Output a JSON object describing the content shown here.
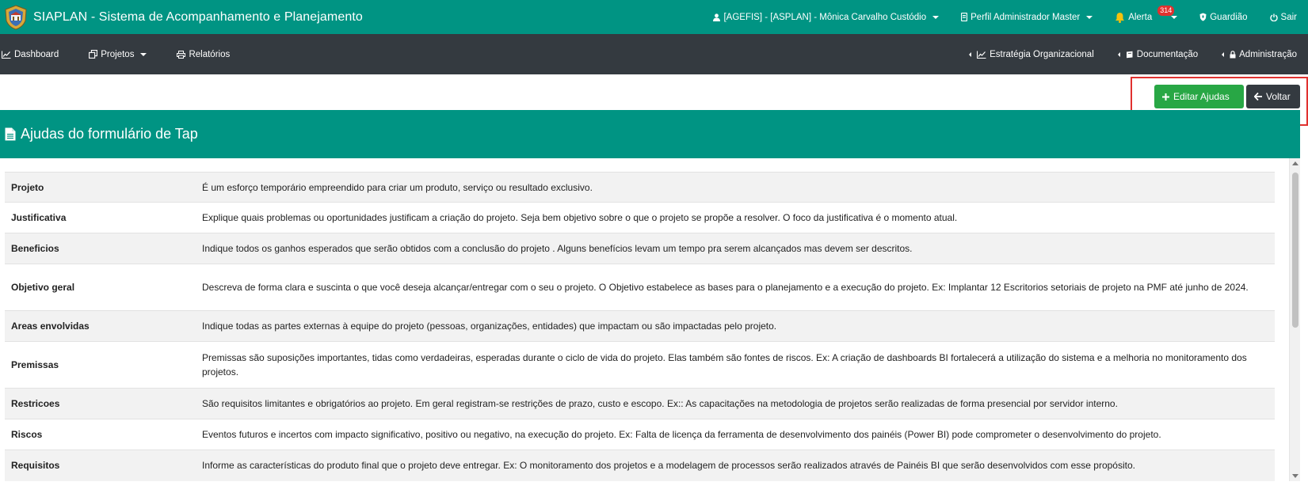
{
  "app": {
    "title": "SIAPLAN - Sistema de Acompanhamento e Planejamento",
    "brand_color": "#009483"
  },
  "topbar": {
    "user_label": "[AGEFIS] - [ASPLAN] - Mônica Carvalho Custódio",
    "profile_label": "Perfil Administrador Master",
    "alert_label": "Alerta",
    "alert_count": "314",
    "guardian_label": "Guardião",
    "exit_label": "Sair"
  },
  "nav": {
    "dashboard": "Dashboard",
    "projetos": "Projetos",
    "relatorios": "Relatórios",
    "estrategia": "Estratégia Organizacional",
    "documentacao": "Documentação",
    "administracao": "Administração"
  },
  "actions": {
    "edit_label": "Editar Ajudas",
    "back_label": "Voltar"
  },
  "panel": {
    "title": "Ajudas do formulário de Tap"
  },
  "rows": [
    {
      "label": "Projeto",
      "desc": "É um esforço temporário empreendido para criar um produto, serviço ou resultado exclusivo."
    },
    {
      "label": "Justificativa",
      "desc": "Explique quais problemas ou oportunidades justificam a criação do projeto. Seja bem objetivo sobre o que o projeto se propõe a resolver. O foco da justificativa é o momento atual."
    },
    {
      "label": "Beneficios",
      "desc": "Indique todos os ganhos esperados que serão obtidos com a conclusão do projeto . Alguns benefícios levam um tempo pra serem alcançados mas devem ser descritos."
    },
    {
      "label": "Objetivo geral",
      "desc": "Descreva de forma clara e suscinta o que você deseja alcançar/entregar com o seu o projeto. O Objetivo estabelece as bases para o planejamento e a execução do projeto. Ex: Implantar 12 Escritorios setoriais de projeto na PMF até junho de 2024."
    },
    {
      "label": "Areas envolvidas",
      "desc": "Indique todas as partes externas à equipe do projeto (pessoas, organizações, entidades) que impactam ou são impactadas pelo projeto."
    },
    {
      "label": "Premissas",
      "desc": "Premissas são suposições importantes, tidas como verdadeiras, esperadas durante o ciclo de vida do projeto. Elas também são fontes de riscos. Ex: A criação de dashboards BI fortalecerá a utilização do sistema e a melhoria no monitoramento dos projetos."
    },
    {
      "label": "Restricoes",
      "desc": "São requisitos limitantes e obrigatórios ao projeto. Em geral registram-se restrições de prazo, custo e escopo. Ex:: As capacitações na metodologia de projetos serão realizadas de forma presencial por servidor interno."
    },
    {
      "label": "Riscos",
      "desc": "Eventos futuros e incertos com impacto significativo, positivo ou negativo, na execução do projeto. Ex: Falta de licença da ferramenta de desenvolvimento dos painéis (Power BI) pode comprometer o desenvolvimento do projeto."
    },
    {
      "label": "Requisitos",
      "desc": "Informe as características do produto final que o projeto deve entregar. Ex: O monitoramento dos projetos e a modelagem de processos serão realizados através de Painéis BI que serão desenvolvidos com esse propósito."
    }
  ]
}
